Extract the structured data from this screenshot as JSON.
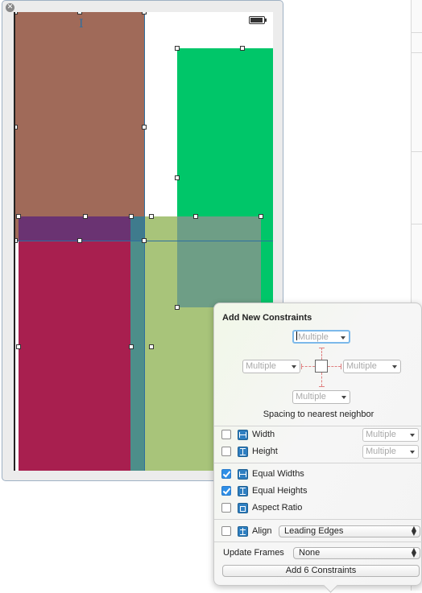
{
  "scene": {
    "close_glyph": "✕"
  },
  "popover": {
    "title": "Add New Constraints",
    "spacing": {
      "top": "Multiple",
      "left": "Multiple",
      "right": "Multiple",
      "bottom": "Multiple",
      "caption": "Spacing to nearest neighbor"
    },
    "width": {
      "label": "Width",
      "checked": false,
      "value": "Multiple"
    },
    "height": {
      "label": "Height",
      "checked": false,
      "value": "Multiple"
    },
    "equal_widths": {
      "label": "Equal Widths",
      "checked": true
    },
    "equal_heights": {
      "label": "Equal Heights",
      "checked": true
    },
    "aspect_ratio": {
      "label": "Aspect Ratio",
      "checked": false
    },
    "align": {
      "label": "Align",
      "checked": false,
      "value": "Leading Edges"
    },
    "update_frames": {
      "label": "Update Frames",
      "value": "None"
    },
    "add_button": "Add 6 Constraints"
  },
  "colors": {
    "brown_view": "#a06a59",
    "green_view": "#00c669",
    "crimson_view": "#a81f4f",
    "olive_view": "#a8c47a",
    "checkbox_accent": "#2e8fe6",
    "guide_line": "#2f6f9f"
  }
}
